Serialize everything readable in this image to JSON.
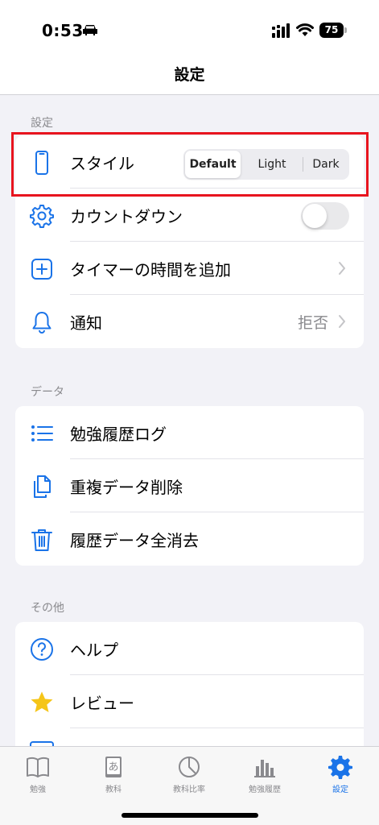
{
  "status": {
    "time": "0:53",
    "battery": "75"
  },
  "nav": {
    "title": "設定"
  },
  "sections": {
    "settings_header": "設定",
    "data_header": "データ",
    "other_header": "その他"
  },
  "settings": {
    "style_label": "スタイル",
    "style_options": [
      "Default",
      "Light",
      "Dark"
    ],
    "style_selected": "Default",
    "countdown_label": "カウントダウン",
    "countdown_on": false,
    "timer_add_label": "タイマーの時間を追加",
    "notification_label": "通知",
    "notification_value": "拒否"
  },
  "data": {
    "log_label": "勉強履歴ログ",
    "dup_delete_label": "重複データ削除",
    "delete_all_label": "履歴データ全消去"
  },
  "other": {
    "help_label": "ヘルプ",
    "review_label": "レビュー"
  },
  "tabs": [
    {
      "label": "勉強",
      "icon": "book-icon"
    },
    {
      "label": "教科",
      "icon": "textbook-icon"
    },
    {
      "label": "教科比率",
      "icon": "pie-chart-icon"
    },
    {
      "label": "勉強履歴",
      "icon": "bar-chart-icon"
    },
    {
      "label": "設定",
      "icon": "gear-icon"
    }
  ],
  "colors": {
    "accent": "#1a73e8",
    "highlight": "#e8141e",
    "star": "#f5c518"
  }
}
